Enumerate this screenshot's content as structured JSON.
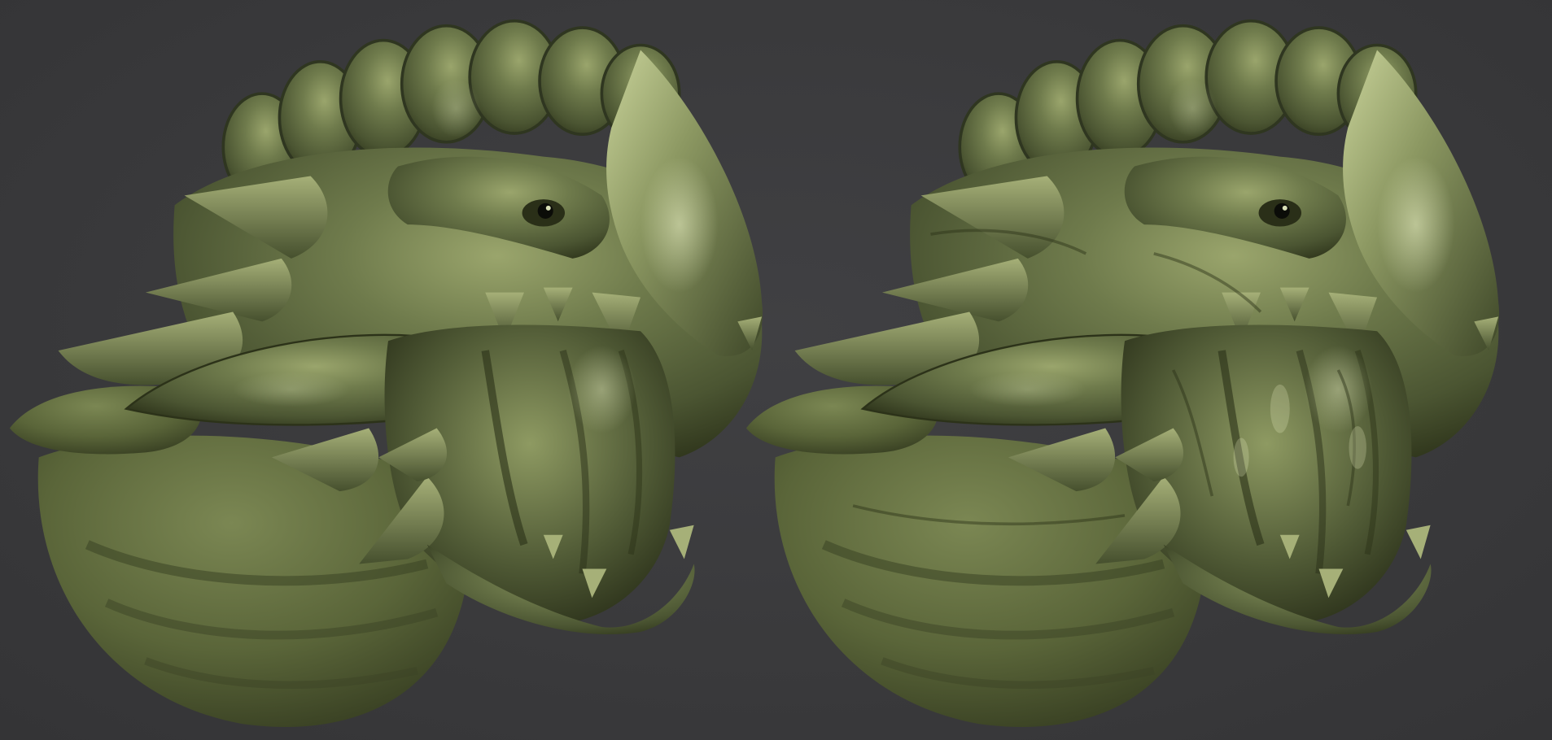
{
  "scene": {
    "description_label": "",
    "background_color": "#3a3a3c",
    "material_color": "#6e7a4c",
    "material_highlight": "#d2dca6",
    "material_shadow": "#1f2412"
  },
  "panels": [
    {
      "id": "left",
      "subject": "dragon-head-sculpt-smooth"
    },
    {
      "id": "right",
      "subject": "dragon-head-sculpt-detailed"
    }
  ]
}
